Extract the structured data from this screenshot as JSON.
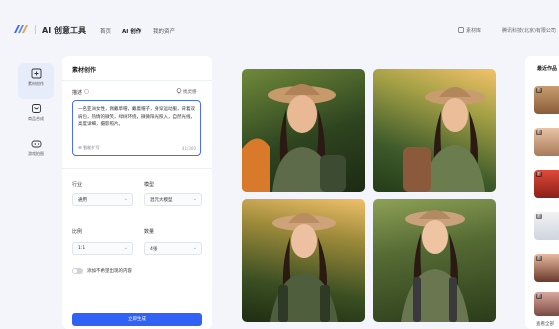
{
  "header": {
    "app_title": "AI 创意工具",
    "nav": [
      "首页",
      "AI 创作",
      "我的资产"
    ],
    "active_nav_index": 1,
    "right_items": [
      "素材库",
      "腾讯科技(北京)有限公司"
    ]
  },
  "rail": {
    "items": [
      {
        "label": "素材创作",
        "icon": "image-edit-icon",
        "active": true
      },
      {
        "label": "商品合成",
        "icon": "product-icon",
        "active": false
      },
      {
        "label": "游戏拍图",
        "icon": "gamepad-icon",
        "active": false
      }
    ]
  },
  "panel": {
    "title": "素材创作",
    "description_label": "描述",
    "examples_link": "找灵感",
    "description_text": "一名亚洲女性，佩戴草帽，戴着帽子，身穿运动服，背着双肩包，热情的微笑，绿树环绕，微微阳光照入，自然光线，高度详细，摄影照片。",
    "smart_expand": "智能扩写",
    "char_count": "41/300",
    "industry_label": "行业",
    "industry_value": "通用",
    "model_label": "模型",
    "model_value": "混元大模型",
    "ratio_label": "比例",
    "ratio_value": "1:1",
    "count_label": "数量",
    "count_value": "4张",
    "exclude_label": "添加不希望出现的内容",
    "generate_button": "立即生成"
  },
  "right_panel": {
    "title": "最近作品",
    "badge": "图",
    "more": "查看全部"
  },
  "colors": {
    "accent": "#2f62f5",
    "panel_bg": "#ffffff",
    "page_bg": "#f3f5fa"
  }
}
